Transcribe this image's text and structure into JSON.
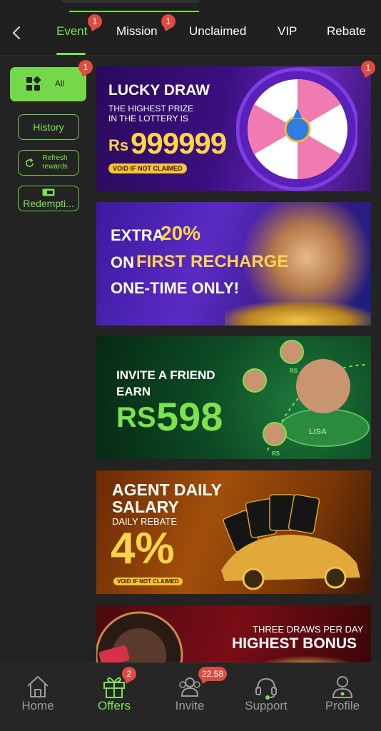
{
  "header": {
    "tabs": [
      {
        "label": "Event",
        "badge": "1",
        "active": true
      },
      {
        "label": "Mission",
        "badge": "1",
        "active": false
      },
      {
        "label": "Unclaimed",
        "badge": "",
        "active": false
      },
      {
        "label": "VIP",
        "badge": "",
        "active": false
      },
      {
        "label": "Rebate",
        "badge": "",
        "active": false
      }
    ],
    "back_icon": "chevron-left-icon",
    "accent": "#7ce34f"
  },
  "sidebar": {
    "all": {
      "label": "All",
      "badge": "1",
      "icon": "grid-icon"
    },
    "history": {
      "label": "History"
    },
    "refresh": {
      "label_line1": "Refresh",
      "label_line2": "rewards",
      "icon": "refresh-icon"
    },
    "redemption": {
      "label": "Redempti...",
      "icon": "ticket-icon"
    }
  },
  "banners": {
    "lucky_draw": {
      "badge": "1",
      "title": "LUCKY DRAW",
      "line1": "THE HIGHEST PRIZE",
      "line2": "IN THE LOTTERY IS",
      "currency": "Rs",
      "amount": "999999",
      "note": "VOID IF NOT CLAIMED"
    },
    "recharge": {
      "l1a": "EXTRA ",
      "l1b": "20%",
      "l2a": "ON ",
      "l2b": "FIRST RECHARGE",
      "l3": "ONE-TIME ONLY!"
    },
    "invite": {
      "line1": "INVITE A FRIEND",
      "line2": "EARN",
      "currency": "RS",
      "amount": "598",
      "rs_small": "RS",
      "name": "LISA"
    },
    "agent": {
      "line1": "AGENT DAILY",
      "line2": "SALARY",
      "line3": "DAILY REBATE",
      "value": "4%",
      "note": "VOID IF NOT CLAIMED"
    },
    "bonus": {
      "line1": "THREE DRAWS PER DAY",
      "line2": "HIGHEST BONUS"
    }
  },
  "bottom_nav": [
    {
      "label": "Home",
      "icon": "home-icon",
      "badge": "",
      "active": false
    },
    {
      "label": "Offers",
      "icon": "gift-icon",
      "badge": "2",
      "active": true
    },
    {
      "label": "Invite",
      "icon": "people-icon",
      "badge": "22.58",
      "active": false
    },
    {
      "label": "Support",
      "icon": "headset-icon",
      "badge": "",
      "active": false
    },
    {
      "label": "Profile",
      "icon": "person-icon",
      "badge": "",
      "active": false
    }
  ]
}
